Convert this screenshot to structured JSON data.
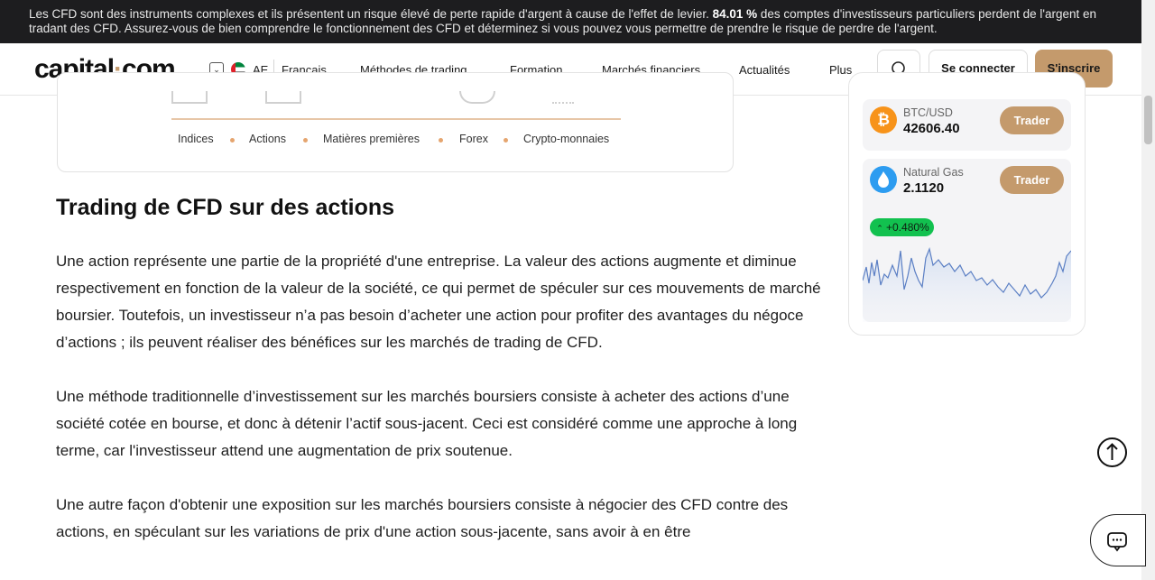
{
  "risk_banner": {
    "text_before": "Les CFD sont des instruments complexes et ils présentent un risque élevé de perte rapide d'argent à cause de l'effet de levier. ",
    "percent": "84.01 %",
    "text_after": " des comptes d'investisseurs particuliers perdent de l'argent en tradant des CFD. Assurez-vous de bien comprendre le fonctionnement des CFD et déterminez si vous pouvez vous permettre de prendre le risque de perdre de l'argent."
  },
  "header": {
    "logo_left": "capital",
    "logo_dot": "·",
    "logo_right": "com",
    "country_code": "AE",
    "language": "Français",
    "menu": [
      "Méthodes de trading",
      "Formation",
      "Marchés financiers",
      "Actualités",
      "Plus"
    ],
    "login_label": "Se connecter",
    "signup_label": "S'inscrire"
  },
  "asset_classes": [
    "Indices",
    "Actions",
    "Matières premières",
    "Forex",
    "Crypto-monnaies"
  ],
  "article": {
    "heading": "Trading de CFD sur des actions",
    "paragraphs": [
      "Une action représente une partie de la propriété d'une entreprise. La valeur des actions augmente et diminue respectivement en fonction de la valeur de la société, ce qui permet de spéculer sur ces mouvements de marché boursier. Toutefois, un investisseur n’a pas besoin d’acheter une action pour profiter des avantages du négoce d’actions ; ils peuvent réaliser des bénéfices sur les marchés de trading de CFD.",
      "Une méthode traditionnelle d’investissement sur les marchés boursiers consiste à acheter des actions d’une société cotée en bourse, et donc à détenir l’actif sous-jacent. Ceci est considéré comme une approche à long terme, car l'investisseur attend une augmentation de prix soutenue.",
      "Une autre façon d'obtenir une exposition sur les marchés boursiers consiste à négocier des CFD contre des actions, en spéculant sur les variations de prix d'une action sous-jacente, sans avoir à en être"
    ]
  },
  "sidebar": {
    "tickers": [
      {
        "name": "BTC/USD",
        "price": "42606.40",
        "button": "Trader",
        "icon": "bitcoin-icon",
        "color": "#f7931a"
      },
      {
        "name": "Natural Gas",
        "price": "2.1120",
        "button": "Trader",
        "icon": "flame-icon",
        "color": "#2d9cf0",
        "change": "+0.480%"
      }
    ]
  },
  "colors": {
    "accent": "#c49a6c",
    "positive": "#12c14f",
    "banner": "#1d1d1f"
  }
}
